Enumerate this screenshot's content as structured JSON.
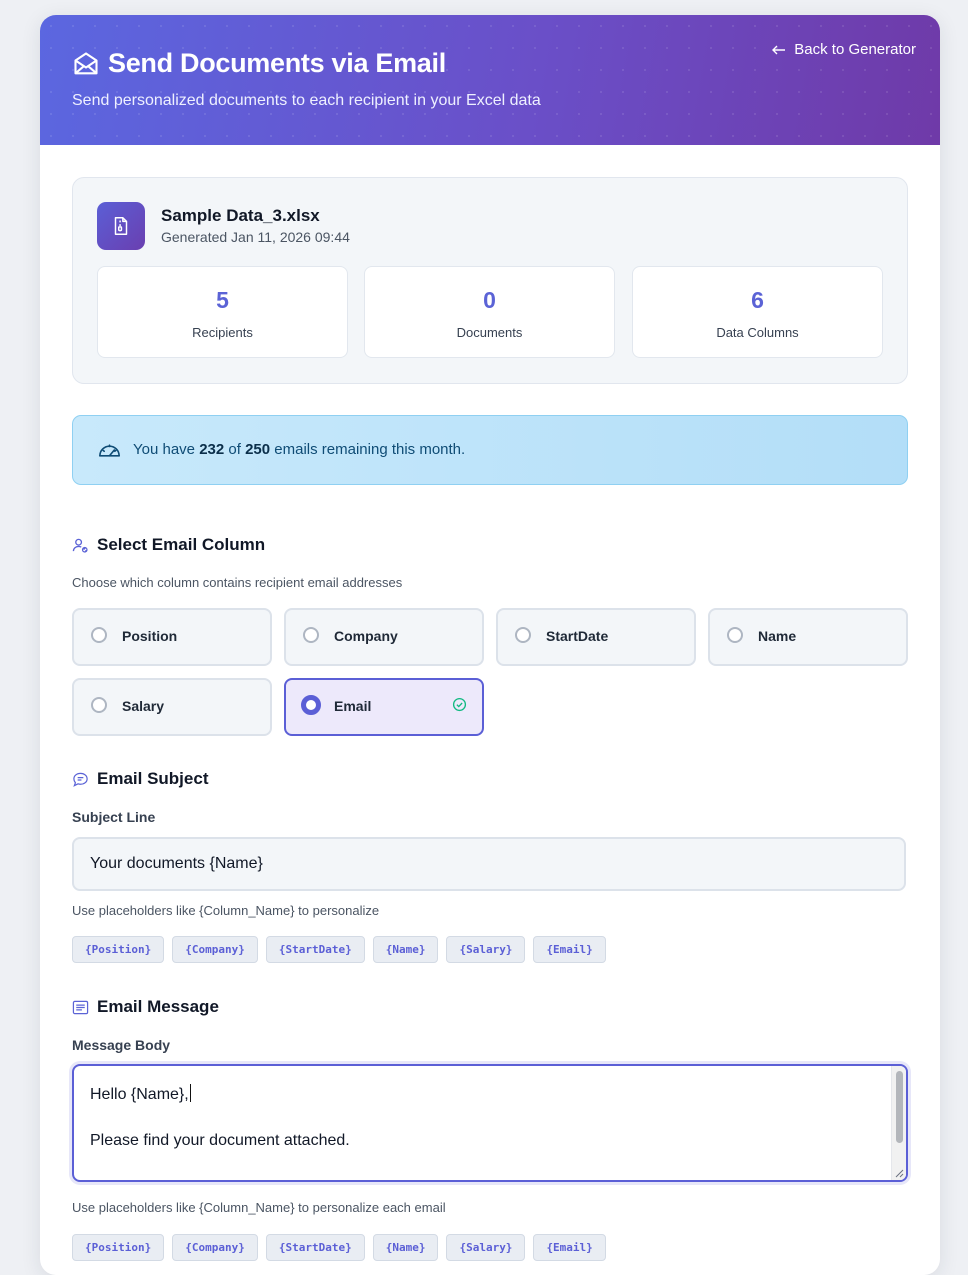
{
  "header": {
    "title": "Send Documents via Email",
    "subtitle": "Send personalized documents to each recipient in your Excel data",
    "back_label": "Back to Generator"
  },
  "file": {
    "name": "Sample Data_3.xlsx",
    "generated": "Generated Jan 11, 2026 09:44"
  },
  "stats": [
    {
      "value": "5",
      "label": "Recipients"
    },
    {
      "value": "0",
      "label": "Documents"
    },
    {
      "value": "6",
      "label": "Data Columns"
    }
  ],
  "quota": {
    "prefix": "You have ",
    "used": "232",
    "middle": " of ",
    "total": "250",
    "suffix": " emails remaining this month."
  },
  "email_column": {
    "heading": "Select Email Column",
    "hint": "Choose which column contains recipient email addresses",
    "options": [
      {
        "label": "Position",
        "selected": false
      },
      {
        "label": "Company",
        "selected": false
      },
      {
        "label": "StartDate",
        "selected": false
      },
      {
        "label": "Name",
        "selected": false
      },
      {
        "label": "Salary",
        "selected": false
      },
      {
        "label": "Email",
        "selected": true
      }
    ]
  },
  "subject": {
    "heading": "Email Subject",
    "label": "Subject Line",
    "value": "Your documents {Name}",
    "hint": "Use placeholders like {Column_Name} to personalize",
    "placeholders": [
      "{Position}",
      "{Company}",
      "{StartDate}",
      "{Name}",
      "{Salary}",
      "{Email}"
    ]
  },
  "message": {
    "heading": "Email Message",
    "label": "Message Body",
    "line1": "Hello {Name},",
    "line2": "Please find your document attached.",
    "hint": "Use placeholders like {Column_Name} to personalize each email",
    "placeholders": [
      "{Position}",
      "{Company}",
      "{StartDate}",
      "{Name}",
      "{Salary}",
      "{Email}"
    ]
  },
  "colors": {
    "accent": "#5b63d6",
    "header_start": "#5b67e0",
    "header_end": "#6f3aa8",
    "quota_bg": "#c8e9fb",
    "success": "#10b981"
  }
}
